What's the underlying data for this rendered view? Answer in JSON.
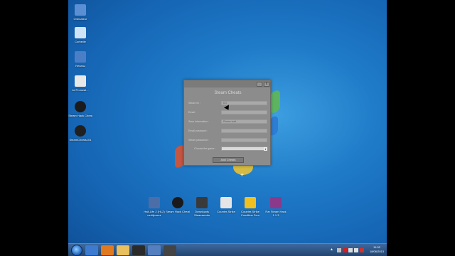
{
  "desktop": {
    "icons_left": [
      {
        "label": "Ordinateur",
        "icon": "computer-icon",
        "color": "#5b8fd4"
      },
      {
        "label": "Corbeille",
        "icon": "recycle-bin-icon",
        "color": "#cfe3f7"
      },
      {
        "label": "Réseau",
        "icon": "network-icon",
        "color": "#4a7fc8"
      },
      {
        "label": "Ici Pronosti...",
        "icon": "document-icon",
        "color": "#e8e8e8"
      },
      {
        "label": "Steam Hack Cheat",
        "icon": "steam-icon",
        "color": "#1b1b1b"
      },
      {
        "label": "SteamCheats101",
        "icon": "steam-icon",
        "color": "#202020"
      }
    ],
    "icons_bottom": [
      {
        "label": "Half-Life 2 (HL2) multijoueur",
        "icon": "hl2-icon",
        "color": "#4b6ea8"
      },
      {
        "label": "Steam Hack Cheat",
        "icon": "steam-icon",
        "color": "#1a1a1a"
      },
      {
        "label": "Downloads Steamworks",
        "icon": "steam-tools-icon",
        "color": "#3a3a3a"
      },
      {
        "label": "Counter-Strike",
        "icon": "cs-icon",
        "color": "#e5e5e5"
      },
      {
        "label": "Counter-Strike Condition Zero",
        "icon": "cs-cz-icon",
        "color": "#f0c020"
      },
      {
        "label": "Rar Steam Hack 1.1.3",
        "icon": "archive-icon",
        "color": "#8b3a8b"
      }
    ]
  },
  "dialog": {
    "title": "Steam Cheats",
    "min_label": "_",
    "close_label": "x",
    "fields": [
      {
        "label": "Steam ID :",
        "value": "8.3"
      },
      {
        "label": "Email :",
        "value": ""
      },
      {
        "label": "Save Information :",
        "value": "Please wait..."
      },
      {
        "label": "Email password :",
        "value": ""
      },
      {
        "label": "Steam password :",
        "value": ""
      },
      {
        "label": "Choose the game :",
        "value": ""
      }
    ],
    "add_button": "Add Cheats"
  },
  "taskbar": {
    "clock_time": "11:02",
    "clock_date": "18/06/2013",
    "items": [
      "explorer-icon",
      "firefox-icon",
      "folder-icon",
      "steam-icon",
      "word-icon",
      "app-icon"
    ]
  },
  "colors": {
    "wallpaper": "#1f7bc8",
    "dialog_bg": "#8c8c8c",
    "taskbar": "#2d5585"
  }
}
